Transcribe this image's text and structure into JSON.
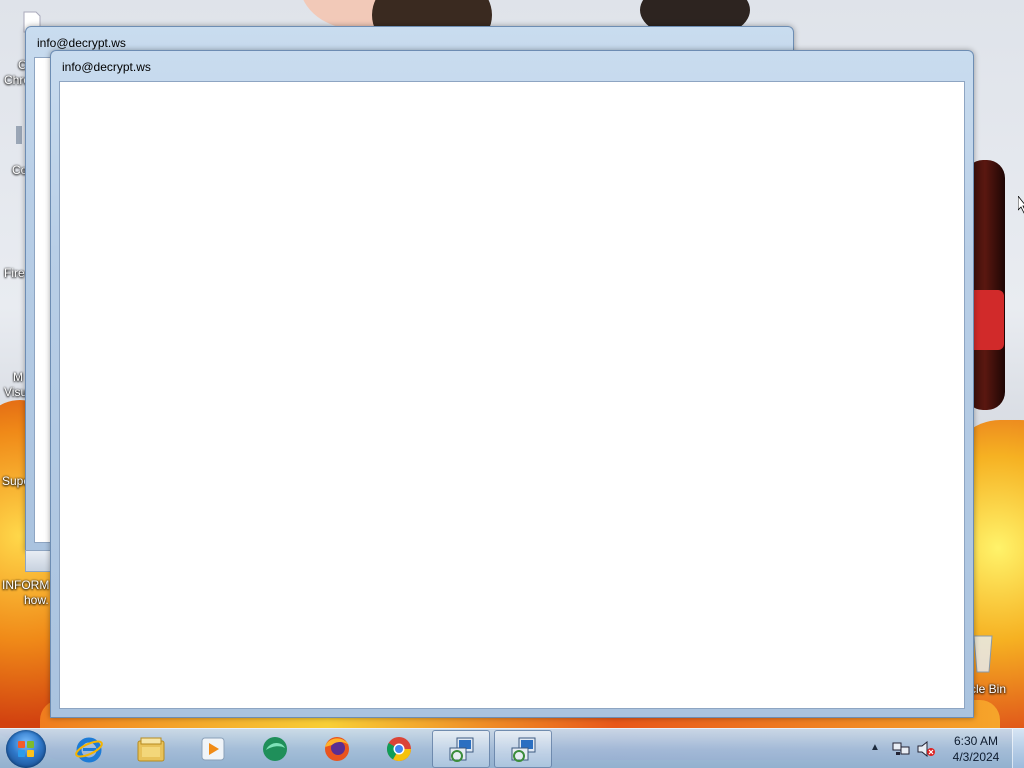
{
  "windows": [
    {
      "title": "info@decrypt.ws"
    },
    {
      "title": "info@decrypt.ws"
    }
  ],
  "desktop_labels": [
    {
      "text": "C"
    },
    {
      "text": "Chro"
    },
    {
      "text": "Co"
    },
    {
      "text": "Fire"
    },
    {
      "text": "M"
    },
    {
      "text": "Visu"
    },
    {
      "text": "Supe"
    },
    {
      "text": "INFORM"
    },
    {
      "text": "how."
    },
    {
      "text": "cle Bin"
    }
  ],
  "taskbar": {
    "start_icon": "windows-start-orb",
    "pinned": [
      {
        "name": "internet-explorer-icon"
      },
      {
        "name": "file-explorer-icon"
      },
      {
        "name": "media-player-icon"
      },
      {
        "name": "app-green-icon"
      },
      {
        "name": "firefox-icon"
      },
      {
        "name": "chrome-icon"
      }
    ],
    "running": [
      {
        "name": "program-window-1-icon"
      },
      {
        "name": "program-window-2-icon"
      }
    ]
  },
  "tray": {
    "chevron": "▲",
    "icons": [
      "network-icon",
      "volume-muted-icon"
    ],
    "time": "6:30 AM",
    "date": "4/3/2024"
  }
}
